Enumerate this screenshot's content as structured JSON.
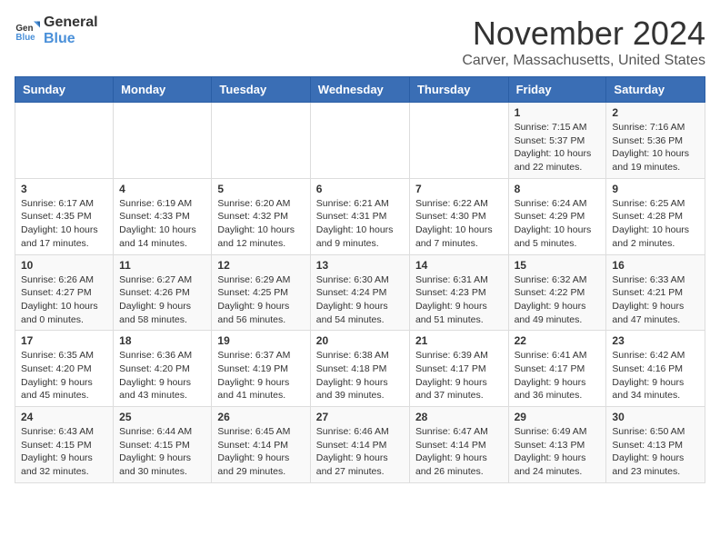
{
  "header": {
    "logo_general": "General",
    "logo_blue": "Blue",
    "month_title": "November 2024",
    "location": "Carver, Massachusetts, United States"
  },
  "days_of_week": [
    "Sunday",
    "Monday",
    "Tuesday",
    "Wednesday",
    "Thursday",
    "Friday",
    "Saturday"
  ],
  "weeks": [
    {
      "days": [
        {
          "number": "",
          "info": ""
        },
        {
          "number": "",
          "info": ""
        },
        {
          "number": "",
          "info": ""
        },
        {
          "number": "",
          "info": ""
        },
        {
          "number": "",
          "info": ""
        },
        {
          "number": "1",
          "info": "Sunrise: 7:15 AM\nSunset: 5:37 PM\nDaylight: 10 hours and 22 minutes."
        },
        {
          "number": "2",
          "info": "Sunrise: 7:16 AM\nSunset: 5:36 PM\nDaylight: 10 hours and 19 minutes."
        }
      ]
    },
    {
      "days": [
        {
          "number": "3",
          "info": "Sunrise: 6:17 AM\nSunset: 4:35 PM\nDaylight: 10 hours and 17 minutes."
        },
        {
          "number": "4",
          "info": "Sunrise: 6:19 AM\nSunset: 4:33 PM\nDaylight: 10 hours and 14 minutes."
        },
        {
          "number": "5",
          "info": "Sunrise: 6:20 AM\nSunset: 4:32 PM\nDaylight: 10 hours and 12 minutes."
        },
        {
          "number": "6",
          "info": "Sunrise: 6:21 AM\nSunset: 4:31 PM\nDaylight: 10 hours and 9 minutes."
        },
        {
          "number": "7",
          "info": "Sunrise: 6:22 AM\nSunset: 4:30 PM\nDaylight: 10 hours and 7 minutes."
        },
        {
          "number": "8",
          "info": "Sunrise: 6:24 AM\nSunset: 4:29 PM\nDaylight: 10 hours and 5 minutes."
        },
        {
          "number": "9",
          "info": "Sunrise: 6:25 AM\nSunset: 4:28 PM\nDaylight: 10 hours and 2 minutes."
        }
      ]
    },
    {
      "days": [
        {
          "number": "10",
          "info": "Sunrise: 6:26 AM\nSunset: 4:27 PM\nDaylight: 10 hours and 0 minutes."
        },
        {
          "number": "11",
          "info": "Sunrise: 6:27 AM\nSunset: 4:26 PM\nDaylight: 9 hours and 58 minutes."
        },
        {
          "number": "12",
          "info": "Sunrise: 6:29 AM\nSunset: 4:25 PM\nDaylight: 9 hours and 56 minutes."
        },
        {
          "number": "13",
          "info": "Sunrise: 6:30 AM\nSunset: 4:24 PM\nDaylight: 9 hours and 54 minutes."
        },
        {
          "number": "14",
          "info": "Sunrise: 6:31 AM\nSunset: 4:23 PM\nDaylight: 9 hours and 51 minutes."
        },
        {
          "number": "15",
          "info": "Sunrise: 6:32 AM\nSunset: 4:22 PM\nDaylight: 9 hours and 49 minutes."
        },
        {
          "number": "16",
          "info": "Sunrise: 6:33 AM\nSunset: 4:21 PM\nDaylight: 9 hours and 47 minutes."
        }
      ]
    },
    {
      "days": [
        {
          "number": "17",
          "info": "Sunrise: 6:35 AM\nSunset: 4:20 PM\nDaylight: 9 hours and 45 minutes."
        },
        {
          "number": "18",
          "info": "Sunrise: 6:36 AM\nSunset: 4:20 PM\nDaylight: 9 hours and 43 minutes."
        },
        {
          "number": "19",
          "info": "Sunrise: 6:37 AM\nSunset: 4:19 PM\nDaylight: 9 hours and 41 minutes."
        },
        {
          "number": "20",
          "info": "Sunrise: 6:38 AM\nSunset: 4:18 PM\nDaylight: 9 hours and 39 minutes."
        },
        {
          "number": "21",
          "info": "Sunrise: 6:39 AM\nSunset: 4:17 PM\nDaylight: 9 hours and 37 minutes."
        },
        {
          "number": "22",
          "info": "Sunrise: 6:41 AM\nSunset: 4:17 PM\nDaylight: 9 hours and 36 minutes."
        },
        {
          "number": "23",
          "info": "Sunrise: 6:42 AM\nSunset: 4:16 PM\nDaylight: 9 hours and 34 minutes."
        }
      ]
    },
    {
      "days": [
        {
          "number": "24",
          "info": "Sunrise: 6:43 AM\nSunset: 4:15 PM\nDaylight: 9 hours and 32 minutes."
        },
        {
          "number": "25",
          "info": "Sunrise: 6:44 AM\nSunset: 4:15 PM\nDaylight: 9 hours and 30 minutes."
        },
        {
          "number": "26",
          "info": "Sunrise: 6:45 AM\nSunset: 4:14 PM\nDaylight: 9 hours and 29 minutes."
        },
        {
          "number": "27",
          "info": "Sunrise: 6:46 AM\nSunset: 4:14 PM\nDaylight: 9 hours and 27 minutes."
        },
        {
          "number": "28",
          "info": "Sunrise: 6:47 AM\nSunset: 4:14 PM\nDaylight: 9 hours and 26 minutes."
        },
        {
          "number": "29",
          "info": "Sunrise: 6:49 AM\nSunset: 4:13 PM\nDaylight: 9 hours and 24 minutes."
        },
        {
          "number": "30",
          "info": "Sunrise: 6:50 AM\nSunset: 4:13 PM\nDaylight: 9 hours and 23 minutes."
        }
      ]
    }
  ]
}
